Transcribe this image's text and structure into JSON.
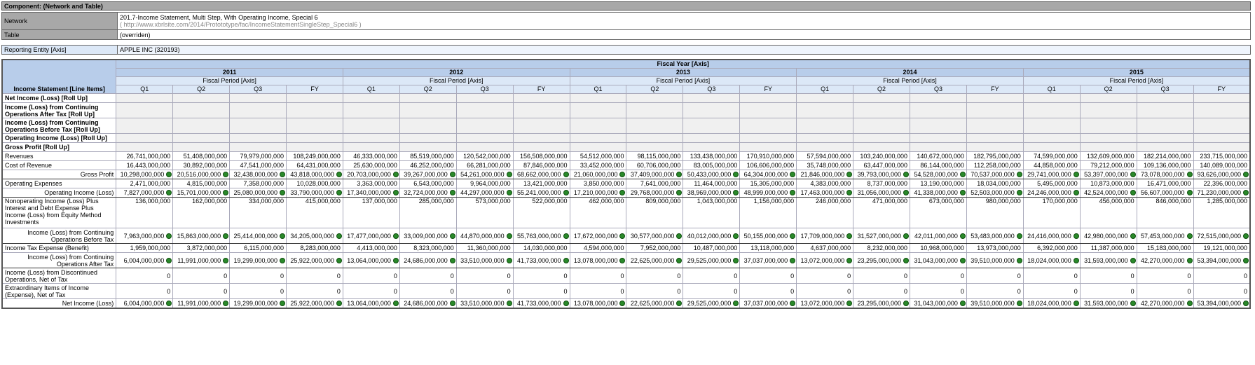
{
  "component_title": "Component: (Network and Table)",
  "network": {
    "label": "Network",
    "name": "201.7-Income Statement, Multi Step, With Operating Income, Special 6",
    "url": "( http://www.xbrlsite.com/2014/Protototype/fac/IncomeStatementSingleStep_Special6 )"
  },
  "table_row": {
    "label": "Table",
    "value": "(overriden)"
  },
  "entity": {
    "label": "Reporting Entity [Axis]",
    "value": "APPLE INC (320193)"
  },
  "grid": {
    "fiscal_year_axis": "Fiscal Year [Axis]",
    "line_items_header": "Income Statement [Line Items]",
    "period_axis": "Fiscal Period [Axis]",
    "years": [
      "2011",
      "2012",
      "2013",
      "2014",
      "2015"
    ],
    "periods": [
      "Q1",
      "Q2",
      "Q3",
      "FY"
    ],
    "rows": [
      {
        "label": "Net Income (Loss) [Roll Up]",
        "style": "b",
        "roll": true,
        "values": []
      },
      {
        "label": "Income (Loss) from Continuing Operations After Tax [Roll Up]",
        "style": "b",
        "roll": true,
        "values": []
      },
      {
        "label": "Income (Loss) from Continuing Operations Before Tax [Roll Up]",
        "style": "b",
        "roll": true,
        "values": []
      },
      {
        "label": "Operating Income (Loss) [Roll Up]",
        "style": "b",
        "roll": true,
        "values": []
      },
      {
        "label": "Gross Profit [Roll Up]",
        "style": "b",
        "roll": true,
        "values": []
      },
      {
        "label": "Revenues",
        "style": "",
        "values": [
          "26,741,000,000",
          "51,408,000,000",
          "79,979,000,000",
          "108,249,000,000",
          "46,333,000,000",
          "85,519,000,000",
          "120,542,000,000",
          "156,508,000,000",
          "54,512,000,000",
          "98,115,000,000",
          "133,438,000,000",
          "170,910,000,000",
          "57,594,000,000",
          "103,240,000,000",
          "140,672,000,000",
          "182,795,000,000",
          "74,599,000,000",
          "132,609,000,000",
          "182,214,000,000",
          "233,715,000,000"
        ]
      },
      {
        "label": "Cost of Revenue",
        "style": "",
        "values": [
          "16,443,000,000",
          "30,892,000,000",
          "47,541,000,000",
          "64,431,000,000",
          "25,630,000,000",
          "46,252,000,000",
          "66,281,000,000",
          "87,846,000,000",
          "33,452,000,000",
          "60,706,000,000",
          "83,005,000,000",
          "106,606,000,000",
          "35,748,000,000",
          "63,447,000,000",
          "86,144,000,000",
          "112,258,000,000",
          "44,858,000,000",
          "79,212,000,000",
          "109,136,000,000",
          "140,089,000,000"
        ]
      },
      {
        "label": "Gross Profit",
        "style": "r",
        "tot": true,
        "dots": true,
        "values": [
          "10,298,000,000",
          "20,516,000,000",
          "32,438,000,000",
          "43,818,000,000",
          "20,703,000,000",
          "39,267,000,000",
          "54,261,000,000",
          "68,662,000,000",
          "21,060,000,000",
          "37,409,000,000",
          "50,433,000,000",
          "64,304,000,000",
          "21,846,000,000",
          "39,793,000,000",
          "54,528,000,000",
          "70,537,000,000",
          "29,741,000,000",
          "53,397,000,000",
          "73,078,000,000",
          "93,626,000,000"
        ]
      },
      {
        "label": "Operating Expenses",
        "style": "",
        "values": [
          "2,471,000,000",
          "4,815,000,000",
          "7,358,000,000",
          "10,028,000,000",
          "3,363,000,000",
          "6,543,000,000",
          "9,964,000,000",
          "13,421,000,000",
          "3,850,000,000",
          "7,641,000,000",
          "11,464,000,000",
          "15,305,000,000",
          "4,383,000,000",
          "8,737,000,000",
          "13,190,000,000",
          "18,034,000,000",
          "5,495,000,000",
          "10,873,000,000",
          "16,471,000,000",
          "22,396,000,000"
        ]
      },
      {
        "label": "Operating Income (Loss)",
        "style": "r",
        "tot": true,
        "dots": true,
        "values": [
          "7,827,000,000",
          "15,701,000,000",
          "25,080,000,000",
          "33,790,000,000",
          "17,340,000,000",
          "32,724,000,000",
          "44,297,000,000",
          "55,241,000,000",
          "17,210,000,000",
          "29,768,000,000",
          "38,969,000,000",
          "48,999,000,000",
          "17,463,000,000",
          "31,056,000,000",
          "41,338,000,000",
          "52,503,000,000",
          "24,246,000,000",
          "42,524,000,000",
          "56,607,000,000",
          "71,230,000,000"
        ]
      },
      {
        "label": "Nonoperating Income (Loss) Plus Interest and Debt Expense Plus Income (Loss) from Equity Method Investments",
        "style": "",
        "tall": true,
        "values": [
          "136,000,000",
          "162,000,000",
          "334,000,000",
          "415,000,000",
          "137,000,000",
          "285,000,000",
          "573,000,000",
          "522,000,000",
          "462,000,000",
          "809,000,000",
          "1,043,000,000",
          "1,156,000,000",
          "246,000,000",
          "471,000,000",
          "673,000,000",
          "980,000,000",
          "170,000,000",
          "456,000,000",
          "846,000,000",
          "1,285,000,000"
        ]
      },
      {
        "label": "Income (Loss) from Continuing Operations Before Tax",
        "style": "r",
        "tot": true,
        "dots": true,
        "values": [
          "7,963,000,000",
          "15,863,000,000",
          "25,414,000,000",
          "34,205,000,000",
          "17,477,000,000",
          "33,009,000,000",
          "44,870,000,000",
          "55,763,000,000",
          "17,672,000,000",
          "30,577,000,000",
          "40,012,000,000",
          "50,155,000,000",
          "17,709,000,000",
          "31,527,000,000",
          "42,011,000,000",
          "53,483,000,000",
          "24,416,000,000",
          "42,980,000,000",
          "57,453,000,000",
          "72,515,000,000"
        ]
      },
      {
        "label": "Income Tax Expense (Benefit)",
        "style": "",
        "values": [
          "1,959,000,000",
          "3,872,000,000",
          "6,115,000,000",
          "8,283,000,000",
          "4,413,000,000",
          "8,323,000,000",
          "11,360,000,000",
          "14,030,000,000",
          "4,594,000,000",
          "7,952,000,000",
          "10,487,000,000",
          "13,118,000,000",
          "4,637,000,000",
          "8,232,000,000",
          "10,968,000,000",
          "13,973,000,000",
          "6,392,000,000",
          "11,387,000,000",
          "15,183,000,000",
          "19,121,000,000"
        ]
      },
      {
        "label": "Income (Loss) from Continuing Operations After Tax",
        "style": "r",
        "tot": true,
        "dots": true,
        "values": [
          "6,004,000,000",
          "11,991,000,000",
          "19,299,000,000",
          "25,922,000,000",
          "13,064,000,000",
          "24,686,000,000",
          "33,510,000,000",
          "41,733,000,000",
          "13,078,000,000",
          "22,625,000,000",
          "29,525,000,000",
          "37,037,000,000",
          "13,072,000,000",
          "23,295,000,000",
          "31,043,000,000",
          "39,510,000,000",
          "18,024,000,000",
          "31,593,000,000",
          "42,270,000,000",
          "53,394,000,000"
        ]
      },
      {
        "label": "Income (Loss) from Discontinued Operations, Net of Tax",
        "style": "",
        "values": [
          "0",
          "0",
          "0",
          "0",
          "0",
          "0",
          "0",
          "0",
          "0",
          "0",
          "0",
          "0",
          "0",
          "0",
          "0",
          "0",
          "0",
          "0",
          "0",
          "0"
        ]
      },
      {
        "label": "Extraordinary Items of Income (Expense), Net of Tax",
        "style": "",
        "values": [
          "0",
          "0",
          "0",
          "0",
          "0",
          "0",
          "0",
          "0",
          "0",
          "0",
          "0",
          "0",
          "0",
          "0",
          "0",
          "0",
          "0",
          "0",
          "0",
          "0"
        ]
      },
      {
        "label": "Net Income (Loss)",
        "style": "r",
        "tot": true,
        "dots": true,
        "values": [
          "6,004,000,000",
          "11,991,000,000",
          "19,299,000,000",
          "25,922,000,000",
          "13,064,000,000",
          "24,686,000,000",
          "33,510,000,000",
          "41,733,000,000",
          "13,078,000,000",
          "22,625,000,000",
          "29,525,000,000",
          "37,037,000,000",
          "13,072,000,000",
          "23,295,000,000",
          "31,043,000,000",
          "39,510,000,000",
          "18,024,000,000",
          "31,593,000,000",
          "42,270,000,000",
          "53,394,000,000"
        ]
      }
    ]
  }
}
